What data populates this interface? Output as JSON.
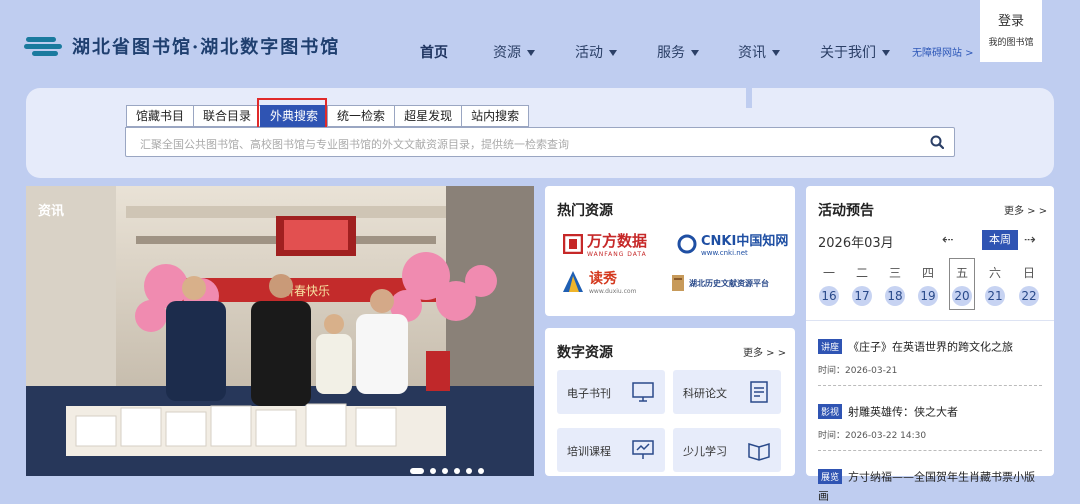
{
  "header": {
    "logo_text": "湖北省图书馆·湖北数字图书馆",
    "nav": [
      {
        "label": "首页",
        "active": true
      },
      {
        "label": "资源"
      },
      {
        "label": "活动"
      },
      {
        "label": "服务"
      },
      {
        "label": "资讯"
      },
      {
        "label": "关于我们"
      }
    ],
    "accessible_link": "无障碍网站 >",
    "login_label": "登录",
    "my_library_label": "我的图书馆"
  },
  "search": {
    "tabs": [
      "馆藏书目",
      "联合目录",
      "外典搜索",
      "统一检索",
      "超星发现",
      "站内搜索"
    ],
    "active_tab_index": 2,
    "placeholder": "汇聚全国公共图书馆、高校图书馆与专业图书馆的外文文献资源目录，提供统一检索查询"
  },
  "news": {
    "label": "资讯",
    "banner_text": "新春快乐",
    "carousel_count": 6,
    "carousel_active_index": 0
  },
  "hot_resources": {
    "title": "热门资源",
    "items": [
      {
        "name": "万方数据",
        "sub": "WANFANG DATA"
      },
      {
        "name": "CNKI中国知网",
        "sub": "www.cnki.net"
      },
      {
        "name": "读秀",
        "sub": "www.duxiu.com"
      },
      {
        "name": "湖北历史文献资源平台",
        "sub": ""
      }
    ]
  },
  "digital_resources": {
    "title": "数字资源",
    "more": "更多 > >",
    "items": [
      "电子书刊",
      "科研论文",
      "培训课程",
      "少儿学习"
    ]
  },
  "events": {
    "title": "活动预告",
    "more": "更多 > >",
    "month": "2026年03月",
    "week_button": "本周",
    "weekdays": [
      "一",
      "二",
      "三",
      "四",
      "五",
      "六",
      "日"
    ],
    "days": [
      "16",
      "17",
      "18",
      "19",
      "20",
      "21",
      "22"
    ],
    "today_index": 4,
    "list": [
      {
        "tag": "讲座",
        "title": "《庄子》在英语世界的跨文化之旅",
        "time": "时间：2026-03-21"
      },
      {
        "tag": "影视",
        "title": "射雕英雄传：侠之大者",
        "time": "时间：2026-03-22 14:30"
      },
      {
        "tag": "展览",
        "title": "方寸纳福——全国贺年生肖藏书票小版画",
        "time": ""
      }
    ]
  },
  "colors": {
    "accent": "#2f54b3",
    "highlight_red": "#e02a2a",
    "background": "#bfcdf0"
  }
}
